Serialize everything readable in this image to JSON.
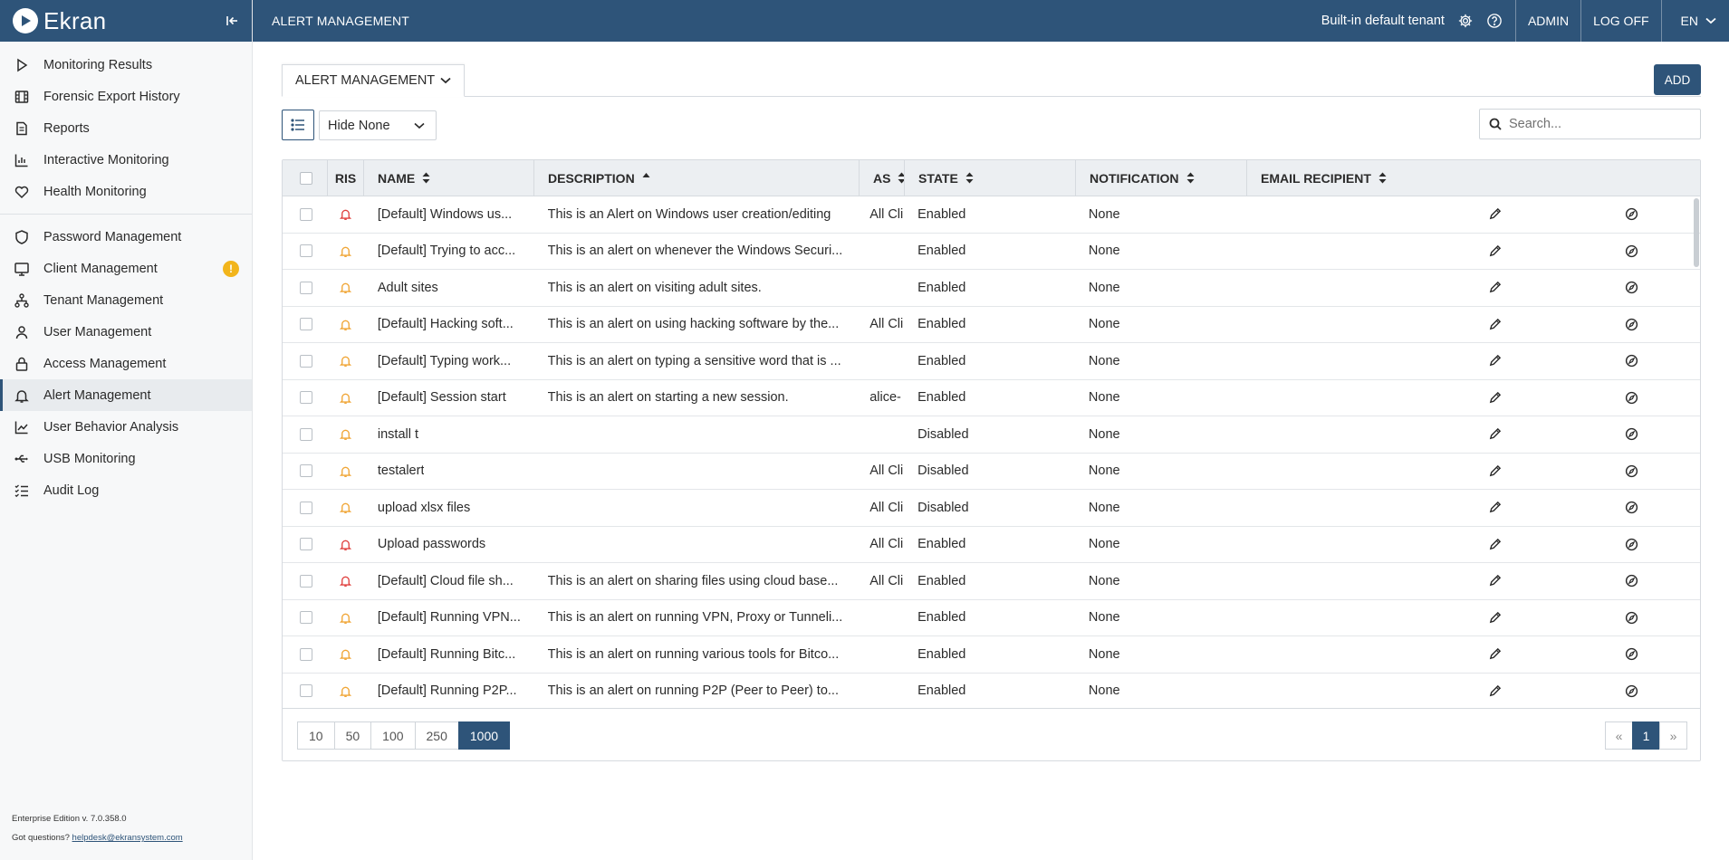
{
  "brand": {
    "name": "Ekran"
  },
  "sidebar": {
    "groups": [
      [
        {
          "label": "Monitoring Results",
          "icon": "play-icon"
        },
        {
          "label": "Forensic Export History",
          "icon": "film-icon"
        },
        {
          "label": "Reports",
          "icon": "document-icon"
        },
        {
          "label": "Interactive Monitoring",
          "icon": "bar-chart-icon"
        },
        {
          "label": "Health Monitoring",
          "icon": "heart-icon"
        }
      ],
      [
        {
          "label": "Password Management",
          "icon": "shield-icon"
        },
        {
          "label": "Client Management",
          "icon": "monitor-icon",
          "badge": "!"
        },
        {
          "label": "Tenant Management",
          "icon": "hierarchy-icon"
        },
        {
          "label": "User Management",
          "icon": "user-icon"
        },
        {
          "label": "Access Management",
          "icon": "lock-icon"
        },
        {
          "label": "Alert Management",
          "icon": "bell-icon",
          "active": true
        },
        {
          "label": "User Behavior Analysis",
          "icon": "trend-icon"
        },
        {
          "label": "USB Monitoring",
          "icon": "usb-icon"
        },
        {
          "label": "Audit Log",
          "icon": "checklist-icon"
        }
      ]
    ],
    "footer": {
      "version": "Enterprise Edition v. 7.0.358.0",
      "questions": "Got questions?",
      "email": "helpdesk@ekransystem.com"
    }
  },
  "header": {
    "title": "ALERT MANAGEMENT",
    "tenant": "Built-in default tenant",
    "admin": "ADMIN",
    "logoff": "LOG OFF",
    "lang": "EN"
  },
  "toolbar": {
    "tab_label": "ALERT MANAGEMENT",
    "add_label": "ADD",
    "filter_value": "Hide None",
    "search_placeholder": "Search..."
  },
  "colors": {
    "accent": "#2e5479",
    "risk_high": "#e0413f",
    "risk_medium": "#f0a535",
    "badge": "#f2b51c"
  },
  "table": {
    "columns": [
      "RIS",
      "NAME",
      "DESCRIPTION",
      "AS",
      "STATE",
      "NOTIFICATION",
      "EMAIL RECIPIENT"
    ],
    "rows": [
      {
        "risk": "high",
        "name": "[Default] Windows us...",
        "description": "This is an Alert on Windows user creation/editing",
        "assigned": "All Cli",
        "state": "Enabled",
        "notification": "None"
      },
      {
        "risk": "medium",
        "name": "[Default] Trying to acc...",
        "description": "This is an alert on whenever the Windows Securi...",
        "assigned": "",
        "state": "Enabled",
        "notification": "None"
      },
      {
        "risk": "medium",
        "name": "Adult sites",
        "description": "This is an alert on visiting adult sites.",
        "assigned": "",
        "state": "Enabled",
        "notification": "None"
      },
      {
        "risk": "medium",
        "name": "[Default] Hacking soft...",
        "description": "This is an alert on using hacking software by the...",
        "assigned": "All Cli",
        "state": "Enabled",
        "notification": "None"
      },
      {
        "risk": "medium",
        "name": "[Default] Typing work...",
        "description": "This is an alert on typing a sensitive word that is ...",
        "assigned": "",
        "state": "Enabled",
        "notification": "None"
      },
      {
        "risk": "medium",
        "name": "[Default] Session start",
        "description": "This is an alert on starting a new session.",
        "assigned": "alice-",
        "state": "Enabled",
        "notification": "None"
      },
      {
        "risk": "medium",
        "name": "install t",
        "description": "",
        "assigned": "",
        "state": "Disabled",
        "notification": "None"
      },
      {
        "risk": "medium",
        "name": "testalert",
        "description": "",
        "assigned": "All Cli",
        "state": "Disabled",
        "notification": "None"
      },
      {
        "risk": "medium",
        "name": "upload xlsx files",
        "description": "",
        "assigned": "All Cli",
        "state": "Disabled",
        "notification": "None"
      },
      {
        "risk": "high",
        "name": "Upload passwords",
        "description": "",
        "assigned": "All Cli",
        "state": "Enabled",
        "notification": "None"
      },
      {
        "risk": "high",
        "name": "[Default] Cloud file sh...",
        "description": "This is an alert on sharing files using cloud base...",
        "assigned": "All Cli",
        "state": "Enabled",
        "notification": "None"
      },
      {
        "risk": "medium",
        "name": "[Default] Running VPN...",
        "description": "This is an alert on running VPN, Proxy or Tunneli...",
        "assigned": "",
        "state": "Enabled",
        "notification": "None"
      },
      {
        "risk": "medium",
        "name": "[Default] Running Bitc...",
        "description": "This is an alert on running various tools for Bitco...",
        "assigned": "",
        "state": "Enabled",
        "notification": "None"
      },
      {
        "risk": "medium",
        "name": "[Default] Running P2P...",
        "description": "This is an alert on running P2P (Peer to Peer) to...",
        "assigned": "",
        "state": "Enabled",
        "notification": "None"
      }
    ]
  },
  "pagination": {
    "sizes": [
      "10",
      "50",
      "100",
      "250",
      "1000"
    ],
    "selected_size": "1000",
    "prev": "«",
    "current": "1",
    "next": "»"
  }
}
